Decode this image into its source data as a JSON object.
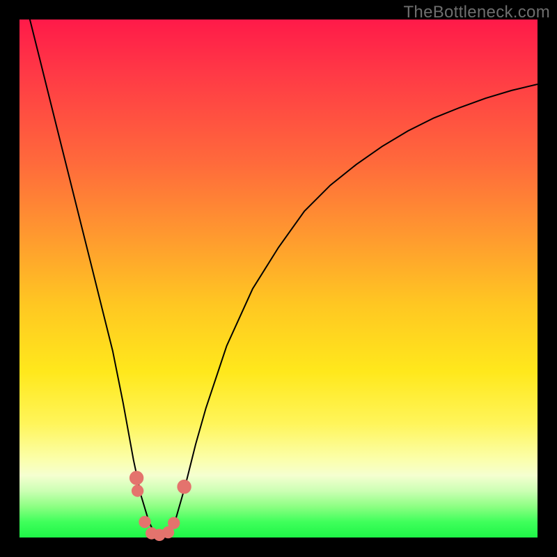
{
  "watermark": "TheBottleneck.com",
  "colors": {
    "frame": "#000000",
    "curve_stroke": "#000000",
    "marker_fill": "#e4736d",
    "marker_stroke": "#e4736d"
  },
  "chart_data": {
    "type": "line",
    "title": "",
    "xlabel": "",
    "ylabel": "",
    "xlim": [
      0,
      100
    ],
    "ylim": [
      0,
      100
    ],
    "grid": false,
    "series": [
      {
        "name": "bottleneck-curve",
        "x": [
          0,
          2,
          4,
          6,
          8,
          10,
          12,
          14,
          16,
          18,
          20,
          22,
          23.5,
          25,
          26,
          27,
          28,
          29,
          30,
          32,
          34,
          36,
          40,
          45,
          50,
          55,
          60,
          65,
          70,
          75,
          80,
          85,
          90,
          95,
          100
        ],
        "values": [
          108,
          100,
          92,
          84,
          76,
          68,
          60,
          52,
          44,
          36,
          26,
          15,
          8,
          3,
          1,
          0,
          0,
          1,
          3,
          10,
          18,
          25,
          37,
          48,
          56,
          63,
          68,
          72,
          75.5,
          78.5,
          81,
          83,
          84.8,
          86.3,
          87.5
        ]
      }
    ],
    "markers": [
      {
        "x": 22.6,
        "y": 11.5,
        "r": 1.3
      },
      {
        "x": 22.8,
        "y": 9.0,
        "r": 1.1
      },
      {
        "x": 24.2,
        "y": 3.0,
        "r": 1.1
      },
      {
        "x": 25.5,
        "y": 0.8,
        "r": 1.1
      },
      {
        "x": 27.0,
        "y": 0.5,
        "r": 1.1
      },
      {
        "x": 28.7,
        "y": 1.0,
        "r": 1.1
      },
      {
        "x": 29.8,
        "y": 2.8,
        "r": 1.1
      },
      {
        "x": 31.8,
        "y": 9.8,
        "r": 1.3
      }
    ]
  }
}
